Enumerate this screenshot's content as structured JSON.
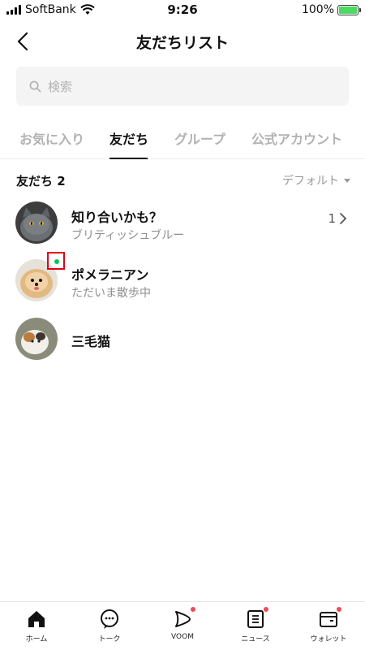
{
  "status_bar": {
    "carrier": "SoftBank",
    "time": "9:26",
    "battery_text": "100%"
  },
  "header": {
    "title": "友だちリスト"
  },
  "search": {
    "placeholder": "検索"
  },
  "tabs": [
    {
      "label": "お気に入り",
      "active": false
    },
    {
      "label": "友だち",
      "active": true
    },
    {
      "label": "グループ",
      "active": false
    },
    {
      "label": "公式アカウント",
      "active": false
    }
  ],
  "section": {
    "title": "友だち 2",
    "sort_label": "デフォルト"
  },
  "friends": [
    {
      "name": "知り合いかも？",
      "status": "ブリティッシュブルー",
      "count": "1"
    },
    {
      "name": "ポメラニアン",
      "status": "ただいま散歩中"
    },
    {
      "name": "三毛猫",
      "status": ""
    }
  ],
  "bottom_nav": [
    {
      "label": "ホーム",
      "icon": "home-icon"
    },
    {
      "label": "トーク",
      "icon": "chat-icon"
    },
    {
      "label": "VOOM",
      "icon": "voom-icon"
    },
    {
      "label": "ニュース",
      "icon": "news-icon"
    },
    {
      "label": "ウォレット",
      "icon": "wallet-icon"
    }
  ],
  "colors": {
    "online_indicator": "#06c755",
    "highlight_box": "#e60012",
    "badge": "#f04857"
  }
}
